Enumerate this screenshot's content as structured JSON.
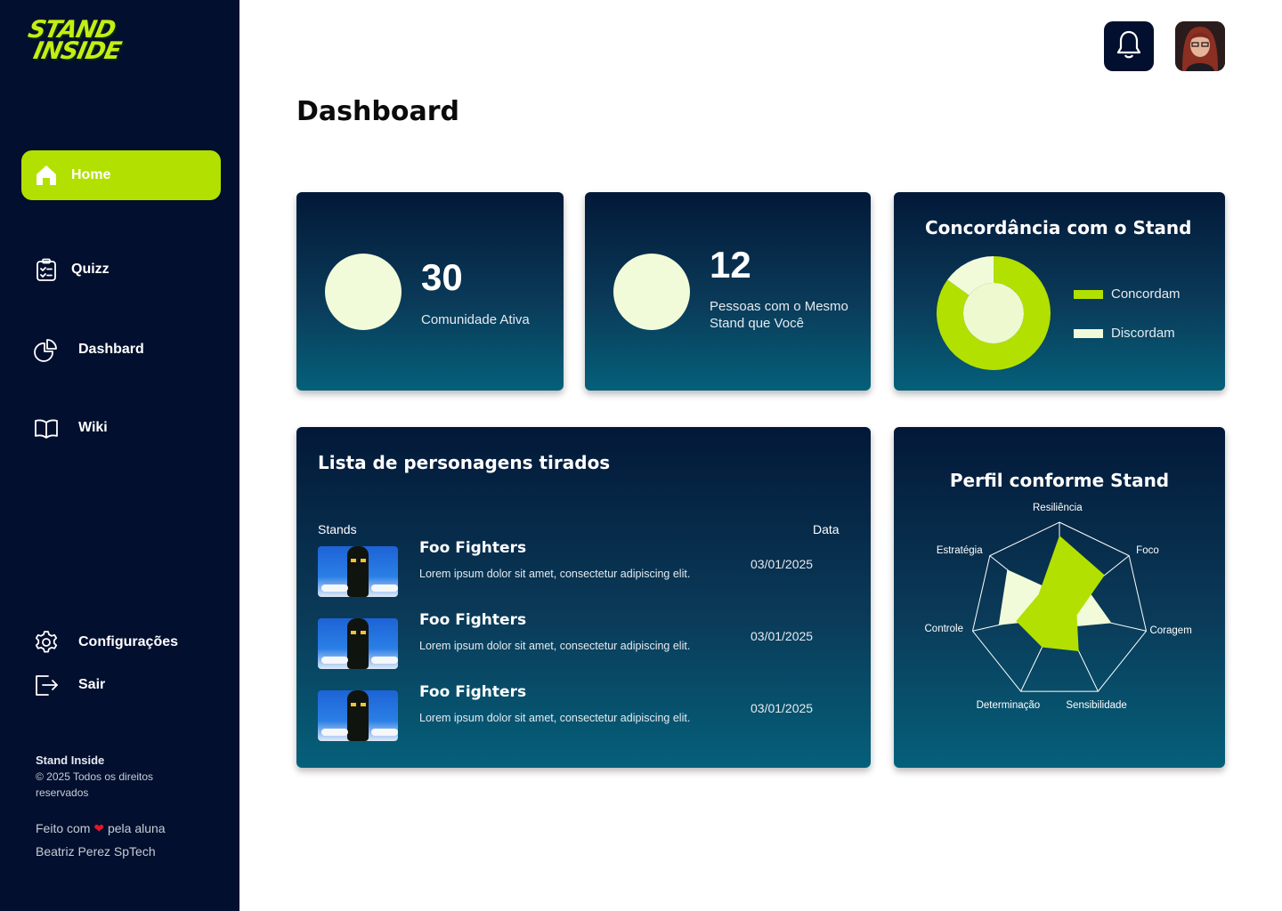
{
  "brand": {
    "logo_line1": "STAND",
    "logo_line2": "INSIDE"
  },
  "sidebar": {
    "items": [
      {
        "label": "Home",
        "icon": "home-icon",
        "active": true
      },
      {
        "label": "Quizz",
        "icon": "clipboard-check-icon"
      },
      {
        "label": "Dashbard",
        "icon": "pie-chart-icon"
      },
      {
        "label": "Wiki",
        "icon": "book-icon"
      }
    ],
    "bottom": [
      {
        "label": "Configurações",
        "icon": "gear-icon"
      },
      {
        "label": "Sair",
        "icon": "logout-icon"
      }
    ],
    "footer": {
      "brand": "Stand Inside",
      "copyright": "© 2025 Todos os direitos reservados",
      "made_prefix": "Feito com",
      "made_suffix": "pela aluna Beatriz Perez SpTech"
    }
  },
  "header": {
    "notification_icon": "bell-icon",
    "avatar": "user-avatar"
  },
  "page": {
    "title": "Dashboard"
  },
  "stats": [
    {
      "value": "30",
      "label": "Comunidade Ativa"
    },
    {
      "value": "12",
      "label": "Pessoas com o Mesmo Stand que Você"
    }
  ],
  "agreement": {
    "title": "Concordância com o Stand",
    "legend": [
      {
        "label": "Concordam",
        "color": "#b2e000"
      },
      {
        "label": "Discordam",
        "color": "#f2fbd9"
      }
    ]
  },
  "list": {
    "title": "Lista de personagens tirados",
    "col_stands": "Stands",
    "col_date": "Data",
    "rows": [
      {
        "name": "Foo Fighters",
        "desc": "Lorem ipsum dolor sit amet, consectetur adipiscing elit.",
        "date": "03/01/2025"
      },
      {
        "name": "Foo Fighters",
        "desc": "Lorem ipsum dolor sit amet, consectetur adipiscing elit.",
        "date": "03/01/2025"
      },
      {
        "name": "Foo Fighters",
        "desc": "Lorem ipsum dolor sit amet, consectetur adipiscing elit.",
        "date": "03/01/2025"
      }
    ]
  },
  "chart_data": [
    {
      "type": "pie",
      "title": "Concordância com o Stand",
      "categories": [
        "Concordam",
        "Discordam"
      ],
      "values": [
        85,
        15
      ],
      "colors": [
        "#b2e000",
        "#f2fbd9"
      ]
    },
    {
      "type": "radar",
      "title": "Perfil conforme Stand",
      "categories": [
        "Resiliência",
        "Foco",
        "Coragem",
        "Sensibilidade",
        "Determinação",
        "Controle",
        "Estratégia"
      ],
      "series": [
        {
          "values": [
            0.2,
            0.4,
            0.6,
            0.2,
            0.1,
            0.7,
            0.75
          ],
          "color": "#f2fbd9"
        },
        {
          "values": [
            0.85,
            0.65,
            0.2,
            0.5,
            0.45,
            0.5,
            0.3
          ],
          "color": "#b2e000"
        }
      ],
      "range": [
        0,
        1
      ]
    }
  ],
  "colors": {
    "sidebar_bg": "#020f2e",
    "accent": "#b2e000",
    "light": "#f2fbd9"
  }
}
